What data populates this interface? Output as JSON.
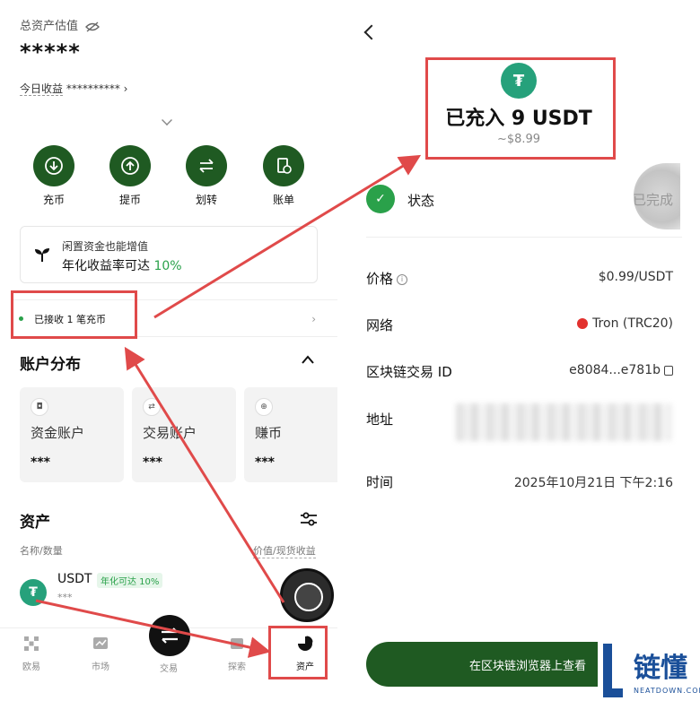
{
  "left": {
    "total_label": "总资产估值",
    "total_value": "*****",
    "today_label": "今日收益",
    "today_value": "**********",
    "today_chev": "›",
    "actions": [
      {
        "label": "充币",
        "icon": "deposit-icon"
      },
      {
        "label": "提币",
        "icon": "withdraw-icon"
      },
      {
        "label": "划转",
        "icon": "transfer-icon"
      },
      {
        "label": "账单",
        "icon": "bill-icon"
      }
    ],
    "promo": {
      "line1": "闲置资金也能增值",
      "line2_prefix": "年化收益率可达",
      "line2_rate": "10%"
    },
    "notice": {
      "text": "已接收 1 笔充币",
      "chev": "›"
    },
    "accounts_title": "账户分布",
    "accounts": [
      {
        "name": "资金账户",
        "value": "***"
      },
      {
        "name": "交易账户",
        "value": "***"
      },
      {
        "name": "赚币",
        "value": "***"
      }
    ],
    "assets_title": "资产",
    "col_left": "名称/数量",
    "col_right": "价值/现货收益",
    "asset": {
      "symbol": "USDT",
      "badge": "年化可达 10%",
      "amount": "***"
    },
    "nav": [
      {
        "label": "欧易",
        "icon": "okx-icon"
      },
      {
        "label": "市场",
        "icon": "market-icon"
      },
      {
        "label": "交易",
        "icon": "trade-icon"
      },
      {
        "label": "探索",
        "icon": "explore-icon"
      },
      {
        "label": "资产",
        "icon": "assets-icon"
      }
    ]
  },
  "right": {
    "title": "已充入 9 USDT",
    "subtitle": "~$8.99",
    "status_label": "状态",
    "status_value": "已完成",
    "rows": {
      "price_label": "价格",
      "price_value": "$0.99/USDT",
      "network_label": "网络",
      "network_value": "Tron (TRC20)",
      "txid_label": "区块链交易 ID",
      "txid_value": "e8084...e781b",
      "address_label": "地址",
      "time_label": "时间",
      "time_value": "2025年10月21日 下午2:16"
    },
    "cta": "在区块链浏览器上查看"
  },
  "watermark": {
    "cn": "链懂",
    "en": "NEATDOWN.COM"
  },
  "colors": {
    "brand_green": "#1f5a22",
    "accent_green": "#2aa14a",
    "annotation_red": "#e04a4a",
    "usdt": "#26a17b"
  }
}
